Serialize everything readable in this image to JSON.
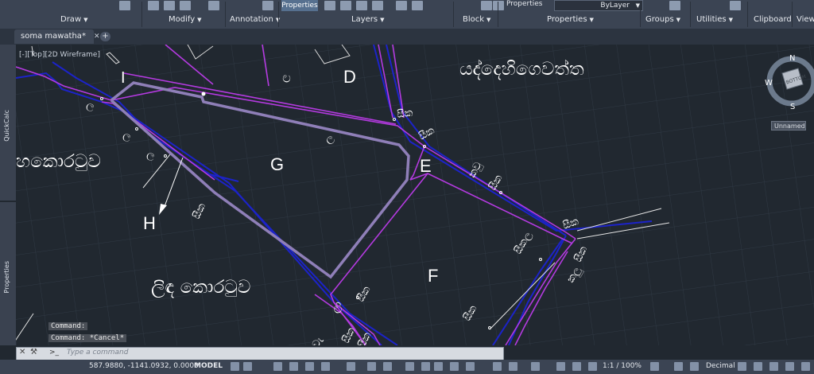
{
  "ribbon": {
    "panels": [
      {
        "label": "Draw"
      },
      {
        "label": "Modify"
      },
      {
        "label": "Annotation"
      },
      {
        "label": "Layers"
      },
      {
        "label": "Block"
      },
      {
        "label": "Properties"
      },
      {
        "label": "Groups"
      },
      {
        "label": "Utilities"
      },
      {
        "label": "Clipboard"
      },
      {
        "label": "View"
      }
    ],
    "properties_button": "Properties",
    "properties_label": "Properties",
    "linetype_value": "ByLayer"
  },
  "document": {
    "tab_label": "soma mawatha*",
    "new_tab": "+"
  },
  "viewport": {
    "label": "[-][Top][2D Wireframe]",
    "viewcube": {
      "n": "N",
      "s": "S",
      "w": "W",
      "face": "BOTTOM"
    },
    "ucs_name": "Unnamed"
  },
  "side_palettes": {
    "quickcalc": "QuickCalc",
    "properties": "Properties"
  },
  "drawing": {
    "parcels": [
      "D",
      "E",
      "F",
      "G",
      "H",
      "I"
    ],
    "annotations": {
      "top_right": "යද්දෙහිගෙවත්ත",
      "left": "හකොරටුව",
      "bottom_left": "ලිඳ කොරටුව",
      "lbl1": "සීක",
      "lbl2": "සීක",
      "lbl3": "සීක",
      "lbl4": "සීක",
      "lbl5": "සීක",
      "lbl6": "සීක",
      "lbl7": "සීක",
      "lbl8": "සීකල",
      "lbl9": "සීක",
      "lbl10": "කලු",
      "lbl11": "ල",
      "lbl12": "ල",
      "lbl13": "ල",
      "lbl14": "ල",
      "lbl15": "ල",
      "lbl16": "ලා",
      "lbl17": "කවු",
      "lbl18": "සීක",
      "lbl19": "සීක",
      "lbl20": "වැ"
    }
  },
  "command": {
    "history": [
      "Command:",
      "Command: *Cancel*"
    ],
    "placeholder": "Type a command"
  },
  "status": {
    "coords": "587.9880, -1141.0932, 0.0000",
    "model": "MODEL",
    "scale": "1:1 / 100%",
    "units": "Decimal"
  },
  "colors": {
    "background": "#212830",
    "grid": "#2f3944",
    "magenta_lines": "#b43ae0",
    "blue_lines": "#1c23c9",
    "lot_boundary": "#8f7fb8",
    "text": "#ffffff"
  }
}
